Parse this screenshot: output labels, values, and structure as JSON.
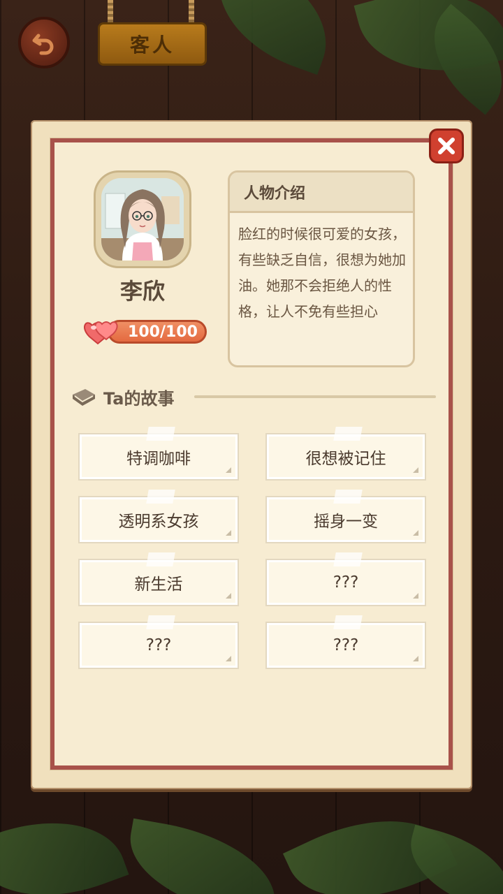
{
  "header": {
    "title": "客人"
  },
  "character": {
    "name": "李欣",
    "affection": "100/100"
  },
  "intro": {
    "title": "人物介绍",
    "text": "脸红的时候很可爱的女孩，有些缺乏自信，很想为她加油。她那不会拒绝人的性格，让人不免有些担心"
  },
  "stories": {
    "title": "Ta的故事",
    "items": [
      {
        "label": "特调咖啡"
      },
      {
        "label": "很想被记住"
      },
      {
        "label": "透明系女孩"
      },
      {
        "label": "摇身一变"
      },
      {
        "label": "新生活"
      },
      {
        "label": "???"
      },
      {
        "label": "???"
      },
      {
        "label": "???"
      }
    ]
  },
  "colors": {
    "panel_border": "#a8524a",
    "close_button": "#d0402f",
    "hp_bar": "#e46a40",
    "title_plank": "#b87b1c"
  }
}
